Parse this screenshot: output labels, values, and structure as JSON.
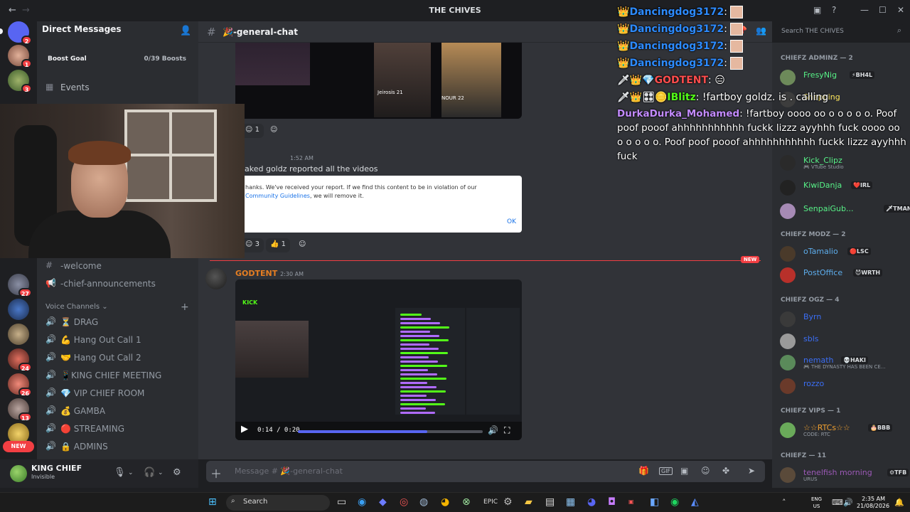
{
  "window": {
    "title": "THE CHIVES",
    "back_icon": "arrow-left-icon",
    "forward_icon": "arrow-right-icon"
  },
  "rail": {
    "badges": [
      "2",
      "1",
      "3",
      "27",
      "24",
      "26",
      "13"
    ],
    "new_label": "NEW"
  },
  "sidebar": {
    "dm_header": "Direct Messages",
    "boost_goal": "Boost Goal",
    "boost_count": "0/39 Boosts",
    "events": "Events",
    "text_channels": [
      {
        "label": "-welcome",
        "icon": "#"
      },
      {
        "label": "-chief-announcements",
        "icon": "📢"
      }
    ],
    "voice_header": "Voice Channels",
    "voice_channels": [
      "⏳ DRAG",
      "💪 Hang Out Call 1",
      "🤝 Hang Out Call 2",
      "📱KING CHIEF MEETING",
      "💎 VIP CHIEF ROOM",
      "💰 GAMBA",
      "🔴 STREAMING",
      "🔒 ADMINS"
    ]
  },
  "user": {
    "name": "KING CHIEF",
    "status": "Invisible"
  },
  "channel": {
    "name": "🎉-general-chat"
  },
  "messages": {
    "top_image_caption1": "Jeirosis 21",
    "top_image_caption2": "NOUR 22",
    "reaction1_count": "1",
    "msg2_time": "1:52 AM",
    "msg2_text": "aked goldz reported all the videos",
    "report_line1": "hanks. We've received your report. If we find this content to be in violation of our",
    "report_link": "Community Guidelines",
    "report_line2_suffix": ", we will remove it.",
    "report_ok": "OK",
    "reaction2_count": "3",
    "reaction3_count": "1",
    "new_label": "NEW",
    "author": "GODTENT",
    "author_time": "2:30 AM",
    "video_kick": "KICK",
    "video_time": "0:14 / 0:20",
    "video_progress": 0.7
  },
  "composer": {
    "placeholder": "Message # 🎉-general-chat"
  },
  "search": {
    "placeholder": "Search THE CHIVES"
  },
  "members": {
    "groups": [
      {
        "title": "CHIEFZ ADMINZ — 2"
      },
      {
        "title": "CHIEFZ MODZ — 2"
      },
      {
        "title": "CHIEFZ OGZ — 4"
      },
      {
        "title": "CHIEFZ VIPS — 1"
      },
      {
        "title": "CHIEFZ — 11"
      }
    ],
    "list": [
      {
        "name": "FresyNig",
        "tag": "⚡BH4L",
        "color": "#57f287"
      },
      {
        "name": "Snapping",
        "tag": "",
        "color": "#fee75c"
      },
      {
        "name": "Kick_Clipz",
        "tag": "",
        "sub": "🎮 VTube Studio",
        "color": "#57f287"
      },
      {
        "name": "KiwiDanja",
        "tag": "❤️IRL",
        "color": "#57f287"
      },
      {
        "name": "SenpaiGub...",
        "tag": "🗡TMAN",
        "color": "#57f287"
      },
      {
        "name": "oTamalio",
        "tag": "🔴LSC",
        "color": "#5dadec"
      },
      {
        "name": "PostOffice",
        "tag": "😈WRTH",
        "color": "#5dadec"
      },
      {
        "name": "Byrn",
        "tag": "",
        "color": "#3b6ef5"
      },
      {
        "name": "sbls",
        "tag": "",
        "color": "#3b6ef5"
      },
      {
        "name": "nemath",
        "tag": "💀HAKI",
        "sub": "🎮 THE DYNASTY HAS BEEN CE...",
        "color": "#3b6ef5"
      },
      {
        "name": "rozzo",
        "tag": "",
        "color": "#3b6ef5"
      },
      {
        "name": "☆☆RTCs☆☆",
        "tag": "🎂BBB",
        "sub": "CODE: RTC",
        "color": "#f0a030"
      },
      {
        "name": "tenelfish morning",
        "tag": "⚙TFB",
        "sub": "URUS",
        "color": "#9b59b6"
      }
    ]
  },
  "overlay_chat": {
    "repeat_name": "Dancingdog3172",
    "line5_name": "GODTENT",
    "line6_name": "IBlitz",
    "line6_text": "!fartboy goldz. is . calling",
    "big_name": "DurkaDurka_Mohamed",
    "big_text": ": !fartboy oooo oo o o o o o. Poof poof pooof ahhhhhhhhhhh fuckk lizzz ayyhhh fuck oooo oo o o o o o. Poof poof pooof ahhhhhhhhhhh fuckk lizzz ayyhhh fuck"
  },
  "taskbar": {
    "search_label": "Search",
    "lang_top": "ENG",
    "lang_bottom": "US",
    "time": "2:35 AM",
    "date": "21/08/2026"
  }
}
